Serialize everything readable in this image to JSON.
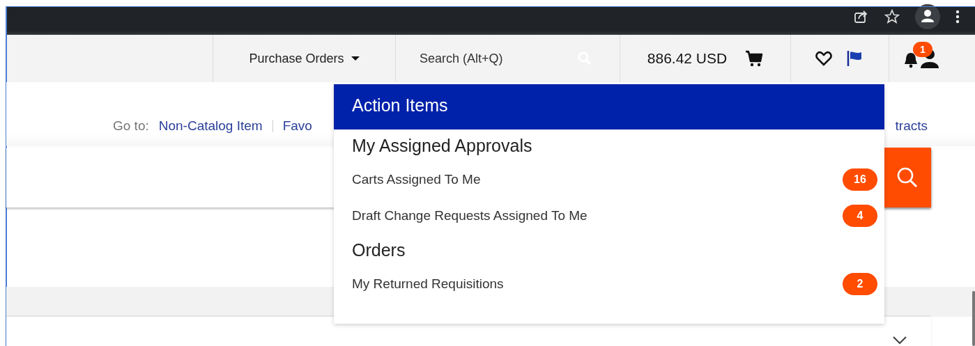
{
  "nav": {
    "menu_label": "Purchase Orders",
    "search": {
      "placeholder": "Search (Alt+Q)"
    },
    "cart_total": "886.42 USD",
    "notification_count": "1"
  },
  "goto": {
    "label": "Go to:",
    "links": [
      "Non-Catalog Item",
      "Favo"
    ],
    "trailing_link": "tracts"
  },
  "dropdown": {
    "title": "Action Items",
    "sections": [
      {
        "heading": "My Assigned Approvals",
        "items": [
          {
            "label": "Carts Assigned To Me",
            "count": "16"
          },
          {
            "label": "Draft Change Requests Assigned To Me",
            "count": "4"
          }
        ]
      },
      {
        "heading": "Orders",
        "items": [
          {
            "label": "My Returned Requisitions",
            "count": "2"
          }
        ]
      }
    ]
  }
}
